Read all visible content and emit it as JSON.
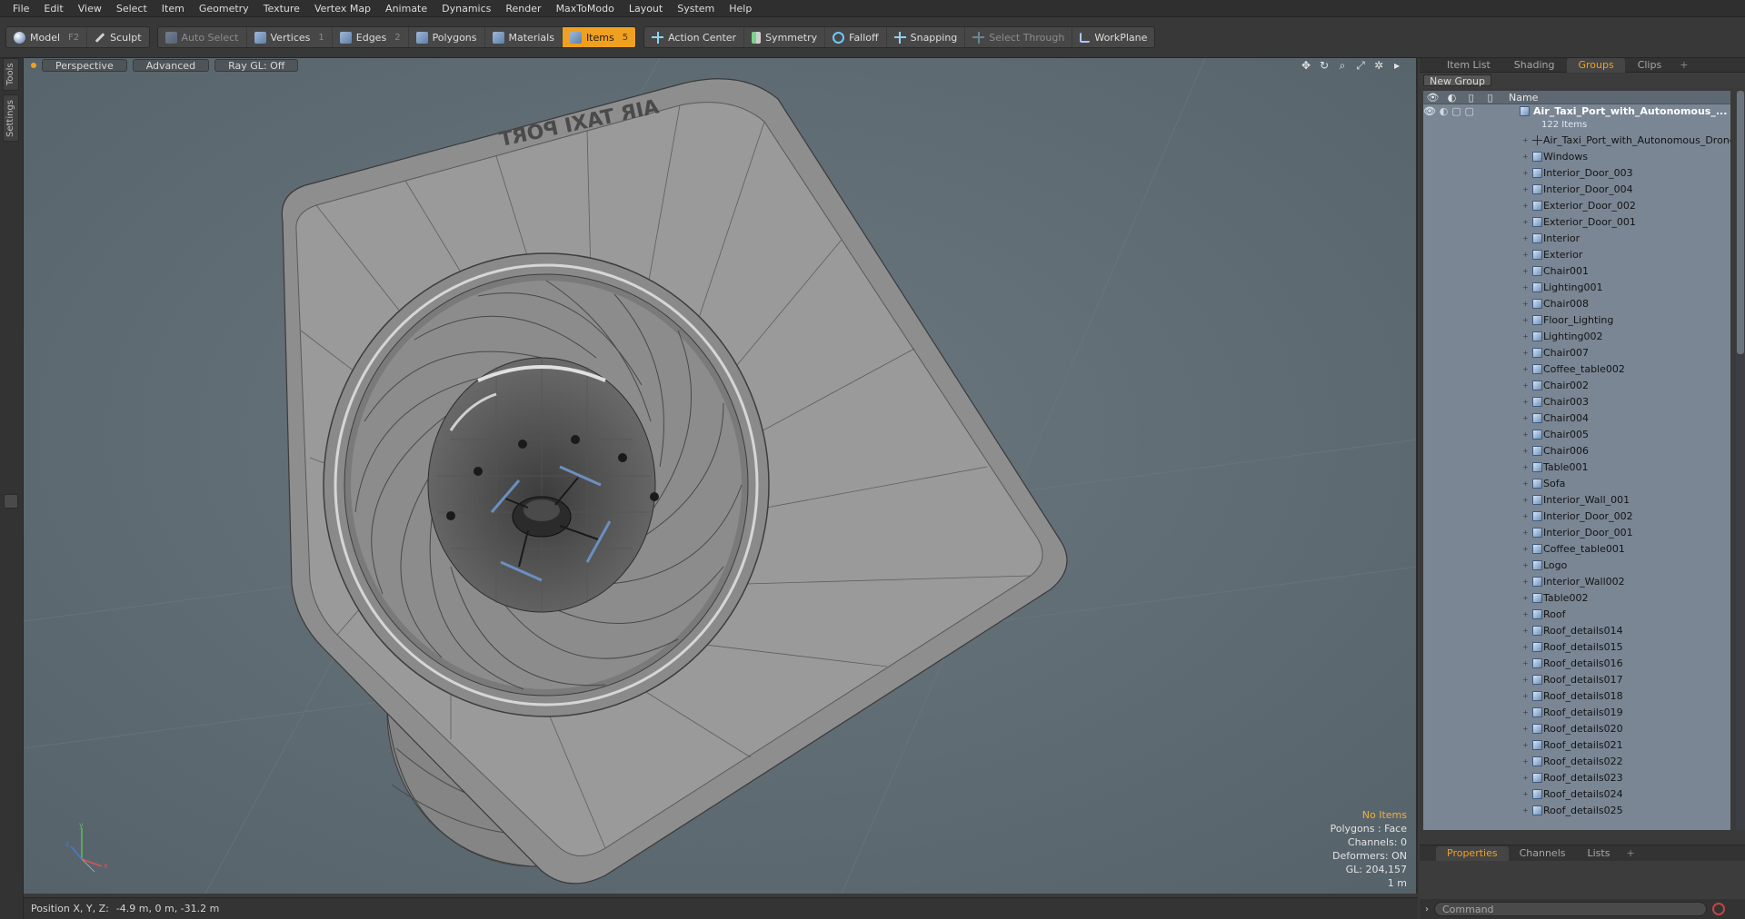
{
  "menu": [
    "File",
    "Edit",
    "View",
    "Select",
    "Item",
    "Geometry",
    "Texture",
    "Vertex Map",
    "Animate",
    "Dynamics",
    "Render",
    "MaxToModo",
    "Layout",
    "System",
    "Help"
  ],
  "toolbar": {
    "model": {
      "label": "Model",
      "key": "F2"
    },
    "sculpt": {
      "label": "Sculpt"
    },
    "auto_select": {
      "label": "Auto Select"
    },
    "vertices": {
      "label": "Vertices",
      "key": "1"
    },
    "edges": {
      "label": "Edges",
      "key": "2"
    },
    "polygons": {
      "label": "Polygons"
    },
    "materials": {
      "label": "Materials"
    },
    "items": {
      "label": "Items",
      "key": "5"
    },
    "action_center": {
      "label": "Action Center"
    },
    "symmetry": {
      "label": "Symmetry"
    },
    "falloff": {
      "label": "Falloff"
    },
    "snapping": {
      "label": "Snapping"
    },
    "select_through": {
      "label": "Select Through"
    },
    "workplane": {
      "label": "WorkPlane"
    },
    "active_color": "#f0a020"
  },
  "left_tabs": [
    "Tools",
    "Settings"
  ],
  "viewport": {
    "view": "Perspective",
    "shading": "Advanced",
    "raygl": "Ray GL: Off",
    "sign_text": "AIR TAXI PORT",
    "info": {
      "selection": "No Items",
      "polygons": "Polygons : Face",
      "channels": "Channels: 0",
      "deformers": "Deformers: ON",
      "gl": "GL: 204,157",
      "scale": "1 m"
    },
    "background_color": "#5f6b72"
  },
  "status": {
    "label": "Position X, Y, Z:",
    "value": "-4.9 m, 0 m, -31.2 m"
  },
  "right_panel": {
    "tabs": [
      "Item List",
      "Shading",
      "Groups",
      "Clips"
    ],
    "active_tab": "Groups",
    "new_group": "New Group",
    "column_name": "Name",
    "root": {
      "label": "Air_Taxi_Port_with_Autonomous_...",
      "count": "122 Items"
    },
    "items": [
      {
        "label": "Air_Taxi_Port_with_Autonomous_Drone",
        "icon": "locator-icon"
      },
      {
        "label": "Windows",
        "icon": "mesh-icon"
      },
      {
        "label": "Interior_Door_003",
        "icon": "mesh-icon"
      },
      {
        "label": "Interior_Door_004",
        "icon": "mesh-icon"
      },
      {
        "label": "Exterior_Door_002",
        "icon": "mesh-icon"
      },
      {
        "label": "Exterior_Door_001",
        "icon": "mesh-icon"
      },
      {
        "label": "Interior",
        "icon": "mesh-icon"
      },
      {
        "label": "Exterior",
        "icon": "mesh-icon"
      },
      {
        "label": "Chair001",
        "icon": "mesh-icon"
      },
      {
        "label": "Lighting001",
        "icon": "mesh-icon"
      },
      {
        "label": "Chair008",
        "icon": "mesh-icon"
      },
      {
        "label": "Floor_Lighting",
        "icon": "mesh-icon"
      },
      {
        "label": "Lighting002",
        "icon": "mesh-icon"
      },
      {
        "label": "Chair007",
        "icon": "mesh-icon"
      },
      {
        "label": "Coffee_table002",
        "icon": "mesh-icon"
      },
      {
        "label": "Chair002",
        "icon": "mesh-icon"
      },
      {
        "label": "Chair003",
        "icon": "mesh-icon"
      },
      {
        "label": "Chair004",
        "icon": "mesh-icon"
      },
      {
        "label": "Chair005",
        "icon": "mesh-icon"
      },
      {
        "label": "Chair006",
        "icon": "mesh-icon"
      },
      {
        "label": "Table001",
        "icon": "mesh-icon"
      },
      {
        "label": "Sofa",
        "icon": "mesh-icon"
      },
      {
        "label": "Interior_Wall_001",
        "icon": "mesh-icon"
      },
      {
        "label": "Interior_Door_002",
        "icon": "mesh-icon"
      },
      {
        "label": "Interior_Door_001",
        "icon": "mesh-icon"
      },
      {
        "label": "Coffee_table001",
        "icon": "mesh-icon"
      },
      {
        "label": "Logo",
        "icon": "mesh-icon"
      },
      {
        "label": "Interior_Wall002",
        "icon": "mesh-icon"
      },
      {
        "label": "Table002",
        "icon": "mesh-icon"
      },
      {
        "label": "Roof",
        "icon": "mesh-icon"
      },
      {
        "label": "Roof_details014",
        "icon": "mesh-icon"
      },
      {
        "label": "Roof_details015",
        "icon": "mesh-icon"
      },
      {
        "label": "Roof_details016",
        "icon": "mesh-icon"
      },
      {
        "label": "Roof_details017",
        "icon": "mesh-icon"
      },
      {
        "label": "Roof_details018",
        "icon": "mesh-icon"
      },
      {
        "label": "Roof_details019",
        "icon": "mesh-icon"
      },
      {
        "label": "Roof_details020",
        "icon": "mesh-icon"
      },
      {
        "label": "Roof_details021",
        "icon": "mesh-icon"
      },
      {
        "label": "Roof_details022",
        "icon": "mesh-icon"
      },
      {
        "label": "Roof_details023",
        "icon": "mesh-icon"
      },
      {
        "label": "Roof_details024",
        "icon": "mesh-icon"
      },
      {
        "label": "Roof_details025",
        "icon": "mesh-icon"
      }
    ],
    "bottom_tabs": [
      "Properties",
      "Channels",
      "Lists"
    ],
    "bottom_active": "Properties",
    "command_placeholder": "Command"
  }
}
